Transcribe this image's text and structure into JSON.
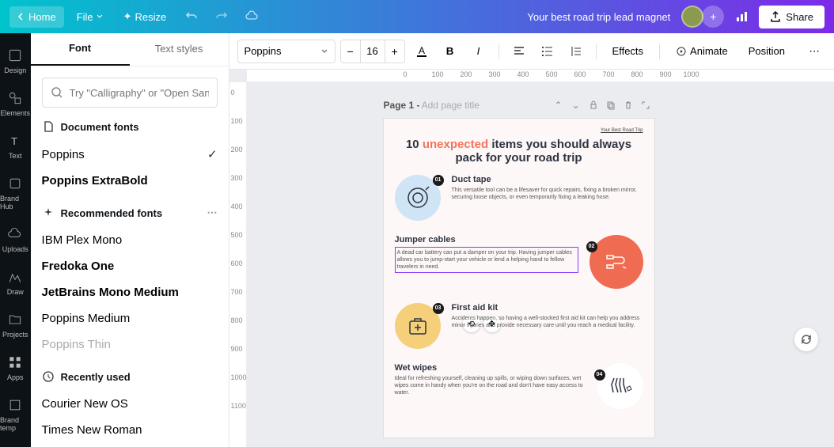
{
  "topbar": {
    "home": "Home",
    "file": "File",
    "resize": "Resize",
    "doc_title": "Your best road trip lead magnet",
    "share": "Share"
  },
  "rail": {
    "design": "Design",
    "elements": "Elements",
    "text": "Text",
    "brand_hub": "Brand Hub",
    "uploads": "Uploads",
    "draw": "Draw",
    "projects": "Projects",
    "apps": "Apps",
    "brand_temp": "Brand temp"
  },
  "panel": {
    "tabs": {
      "font": "Font",
      "text_styles": "Text styles"
    },
    "search_placeholder": "Try \"Calligraphy\" or \"Open Sans\"",
    "doc_fonts_hdr": "Document fonts",
    "rec_fonts_hdr": "Recommended fonts",
    "recent_hdr": "Recently used",
    "fonts": {
      "poppins": "Poppins",
      "poppins_eb": "Poppins ExtraBold",
      "ibm_plex": "IBM Plex Mono",
      "fredoka": "Fredoka One",
      "jetbrains": "JetBrains Mono Medium",
      "poppins_m": "Poppins Medium",
      "poppins_t": "Poppins Thin",
      "courier": "Courier New OS",
      "times": "Times New Roman"
    }
  },
  "ctx": {
    "font_name": "Poppins",
    "font_size": "16",
    "effects": "Effects",
    "animate": "Animate",
    "position": "Position"
  },
  "ruler_h": [
    "0",
    "100",
    "200",
    "300",
    "400",
    "500",
    "600",
    "700",
    "800",
    "900",
    "1000"
  ],
  "ruler_v": [
    "0",
    "100",
    "200",
    "300",
    "400",
    "500",
    "600",
    "700",
    "800",
    "900",
    "1000",
    "1100"
  ],
  "page_hdr": {
    "label": "Page 1 -",
    "placeholder": "Add page title"
  },
  "doc": {
    "breadcrumb": "Your Best Road Trip",
    "title_pre": "10 ",
    "title_accent": "unexpected",
    "title_post": " items you should always pack for your road trip",
    "items": [
      {
        "num": "01",
        "title": "Duct tape",
        "desc": "This versatile tool can be a lifesaver for quick repairs, fixing a broken mirror, securing loose objects, or even temporarily fixing a leaking hose."
      },
      {
        "num": "02",
        "title": "Jumper cables",
        "desc": "A dead car battery can put a damper on your trip. Having jumper cables allows you to jump-start your vehicle or lend a helping hand to fellow travelers in need."
      },
      {
        "num": "03",
        "title": "First aid kit",
        "desc": "Accidents happen, so having a well-stocked first aid kit can help you address minor injuries and provide necessary care until you reach a medical facility."
      },
      {
        "num": "04",
        "title": "Wet wipes",
        "desc": "Ideal for refreshing yourself, cleaning up spills, or wiping down surfaces, wet wipes come in handy when you're on the road and don't have easy access to water."
      }
    ]
  }
}
